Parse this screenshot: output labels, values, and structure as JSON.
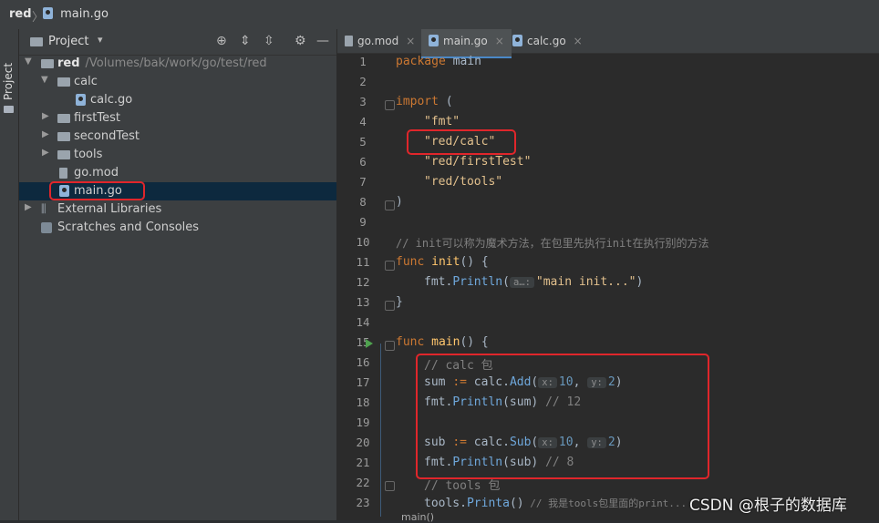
{
  "breadcrumb": {
    "project": "red",
    "separator": "〉",
    "file": "main.go"
  },
  "stripe": {
    "label": "Project"
  },
  "project_panel": {
    "title": "Project",
    "caret": "▾",
    "icons": [
      "crosshair-icon",
      "expand-all-icon",
      "collapse-all-icon",
      "gear-icon",
      "minimize-icon"
    ],
    "icon_glyphs": {
      "crosshair": "⊕",
      "expand": "⇕",
      "collapse": "⇳",
      "gear": "⚙",
      "minimize": "—"
    },
    "tree": [
      {
        "label": "red",
        "path": "/Volumes/bak/work/go/test/red"
      },
      {
        "label": "calc"
      },
      {
        "label": "calc.go"
      },
      {
        "label": "firstTest"
      },
      {
        "label": "secondTest"
      },
      {
        "label": "tools"
      },
      {
        "label": "go.mod"
      },
      {
        "label": "main.go",
        "selected": true
      },
      {
        "label": "External Libraries"
      },
      {
        "label": "Scratches and Consoles"
      }
    ]
  },
  "tabs": [
    {
      "label": "go.mod",
      "close": "×"
    },
    {
      "label": "main.go",
      "close": "×",
      "active": true
    },
    {
      "label": "calc.go",
      "close": "×"
    }
  ],
  "line_numbers": [
    "1",
    "2",
    "3",
    "4",
    "5",
    "6",
    "7",
    "8",
    "9",
    "10",
    "11",
    "12",
    "13",
    "14",
    "15",
    "16",
    "17",
    "18",
    "19",
    "20",
    "21",
    "22",
    "23"
  ],
  "code": {
    "l1_kw": "package",
    "l1_name": " main",
    "l3_kw": "import",
    "l3_rest": " (",
    "l4": "\"fmt\"",
    "l5": "\"red/calc\"",
    "l6": "\"red/firstTest\"",
    "l7": "\"red/tools\"",
    "l8": ")",
    "l10": "// init可以称为魔术方法，在包里先执行init在执行别的方法",
    "l11_kw": "func",
    "l11_fn": " init",
    "l11_rest": "() {",
    "l12_pkg": "fmt.",
    "l12_call": "Println",
    "l12_open": "(",
    "l12_hint": "a…:",
    "l12_str": "\"main init...\"",
    "l12_close": ")",
    "l13": "}",
    "l15_kw": "func",
    "l15_fn": " main",
    "l15_rest": "() {",
    "l16": "// calc 包",
    "l17_a": "sum ",
    "l17_op": ":=",
    "l17_b": " calc.",
    "l17_call": "Add",
    "l17_open": "(",
    "l17_hint1": "x:",
    "l17_n1": "10",
    "l17_comma": ", ",
    "l17_hint2": "y:",
    "l17_n2": "2",
    "l17_close": ")",
    "l18_pkg": "fmt.",
    "l18_call": "Println",
    "l18_arg": "(sum)",
    "l18_cm": " // 12",
    "l20_a": "sub ",
    "l20_op": ":=",
    "l20_b": " calc.",
    "l20_call": "Sub",
    "l20_open": "(",
    "l20_hint1": "x:",
    "l20_n1": "10",
    "l20_comma": ", ",
    "l20_hint2": "y:",
    "l20_n2": "2",
    "l20_close": ")",
    "l21_pkg": "fmt.",
    "l21_call": "Println",
    "l21_arg": "(sub)",
    "l21_cm": " // 8",
    "l22": "// tools 包",
    "l23_a": "tools.",
    "l23_call": "Printa",
    "l23_rest": "()",
    "l23_cm": " // 我是tools包里面的print..."
  },
  "bottom_crumb": "main()",
  "watermark": "CSDN @根子的数据库",
  "colors": {
    "keyword": "#cc7832",
    "string": "#e2c08d",
    "comment": "#808080",
    "number": "#6897bb",
    "highlight_box": "#e0262b",
    "selection": "#0d293e"
  }
}
